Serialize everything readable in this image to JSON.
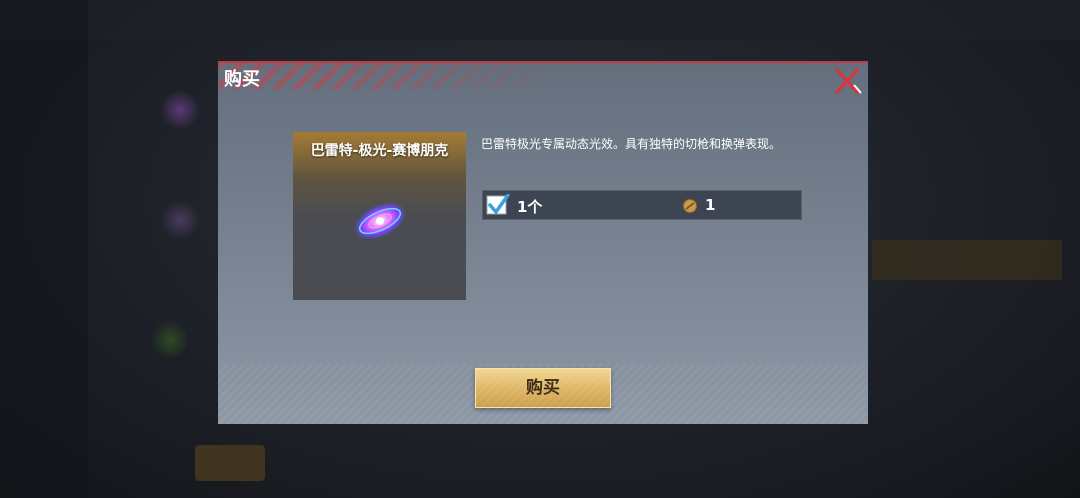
{
  "dialog": {
    "title": "购买",
    "close_icon": "close-x-icon"
  },
  "item": {
    "name": "巴雷特-极光-赛博朋克",
    "icon": "galaxy-effect-icon",
    "description": "巴雷特极光专属动态光效。具有独特的切枪和换弹表现。"
  },
  "option": {
    "checked": true,
    "quantity_label": "1个",
    "currency_icon": "coin-icon",
    "price": "1"
  },
  "buy_button": {
    "label": "购买"
  },
  "colors": {
    "accent_red": "#c23a44",
    "button_gold": "#dfb566",
    "check_blue": "#3aa0e0"
  }
}
